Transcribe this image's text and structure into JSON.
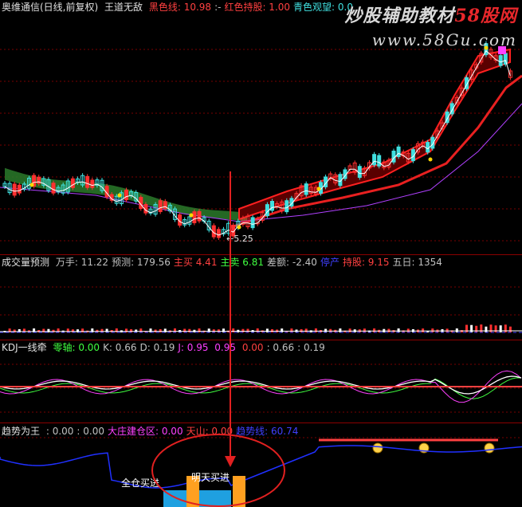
{
  "main": {
    "title": "奥维通信(日线,前复权)",
    "indicator": "王道无敌",
    "items": [
      {
        "label": "黑色线:",
        "value": "10.98",
        "color": "#ff4040"
      },
      {
        "label": ":-",
        "value": "",
        "color": "#c0c0c0"
      },
      {
        "label": "红色持股:",
        "value": "1.00",
        "color": "#ff4040"
      },
      {
        "label": "青色观望:",
        "value": "0.0",
        "color": "#40e0e0"
      }
    ],
    "low_label": "←5.25"
  },
  "watermark": {
    "line1_a": "炒股辅助教材",
    "line1_b": "58股网",
    "line2": "www.58Gu.com"
  },
  "volume": {
    "name": "成交量预测",
    "items": [
      {
        "label": "万手:",
        "value": "11.22",
        "color": "#c0c0c0"
      },
      {
        "label": "预测:",
        "value": "179.56",
        "color": "#c0c0c0"
      },
      {
        "label": "主买",
        "value": "4.41",
        "color": "#ff4040"
      },
      {
        "label": "主卖",
        "value": "6.81",
        "color": "#40ff40"
      },
      {
        "label": "差额:",
        "value": "-2.40",
        "color": "#c0c0c0"
      },
      {
        "label": "停产",
        "value": "",
        "color": "#4040ff"
      },
      {
        "label": "持股:",
        "value": "9.15",
        "color": "#ff4040"
      },
      {
        "label": "五日:",
        "value": "1354",
        "color": "#c0c0c0"
      }
    ]
  },
  "kdj": {
    "name": "KDJ一线牵",
    "items": [
      {
        "label": "零轴:",
        "value": "0.00",
        "color": "#40ff40"
      },
      {
        "label": "K:",
        "value": "0.66",
        "color": "#c0c0c0"
      },
      {
        "label": "D:",
        "value": "0.19",
        "color": "#c0c0c0"
      },
      {
        "label": "J:",
        "value": "0.95",
        "color": "#ff40ff"
      },
      {
        "label": "",
        "value": "0.95",
        "color": "#ff40ff"
      },
      {
        "label": "",
        "value": "0.00",
        "color": "#ff4040"
      },
      {
        "label": ":",
        "value": "0.66",
        "color": "#c0c0c0"
      },
      {
        "label": ":",
        "value": "0.19",
        "color": "#c0c0c0"
      }
    ]
  },
  "trend": {
    "name": "趋势为王",
    "items": [
      {
        "label": ":",
        "value": "0.00",
        "color": "#c0c0c0"
      },
      {
        "label": ":",
        "value": "0.00",
        "color": "#c0c0c0"
      },
      {
        "label": "大庄建仓区:",
        "value": "0.00",
        "color": "#ff40ff"
      },
      {
        "label": "天山:",
        "value": "0.00",
        "color": "#ff4040"
      },
      {
        "label": "趋势线:",
        "value": "60.74",
        "color": "#4040ff"
      }
    ],
    "full_buy": "全仓买进",
    "tomorrow_buy": "明天买进"
  }
}
